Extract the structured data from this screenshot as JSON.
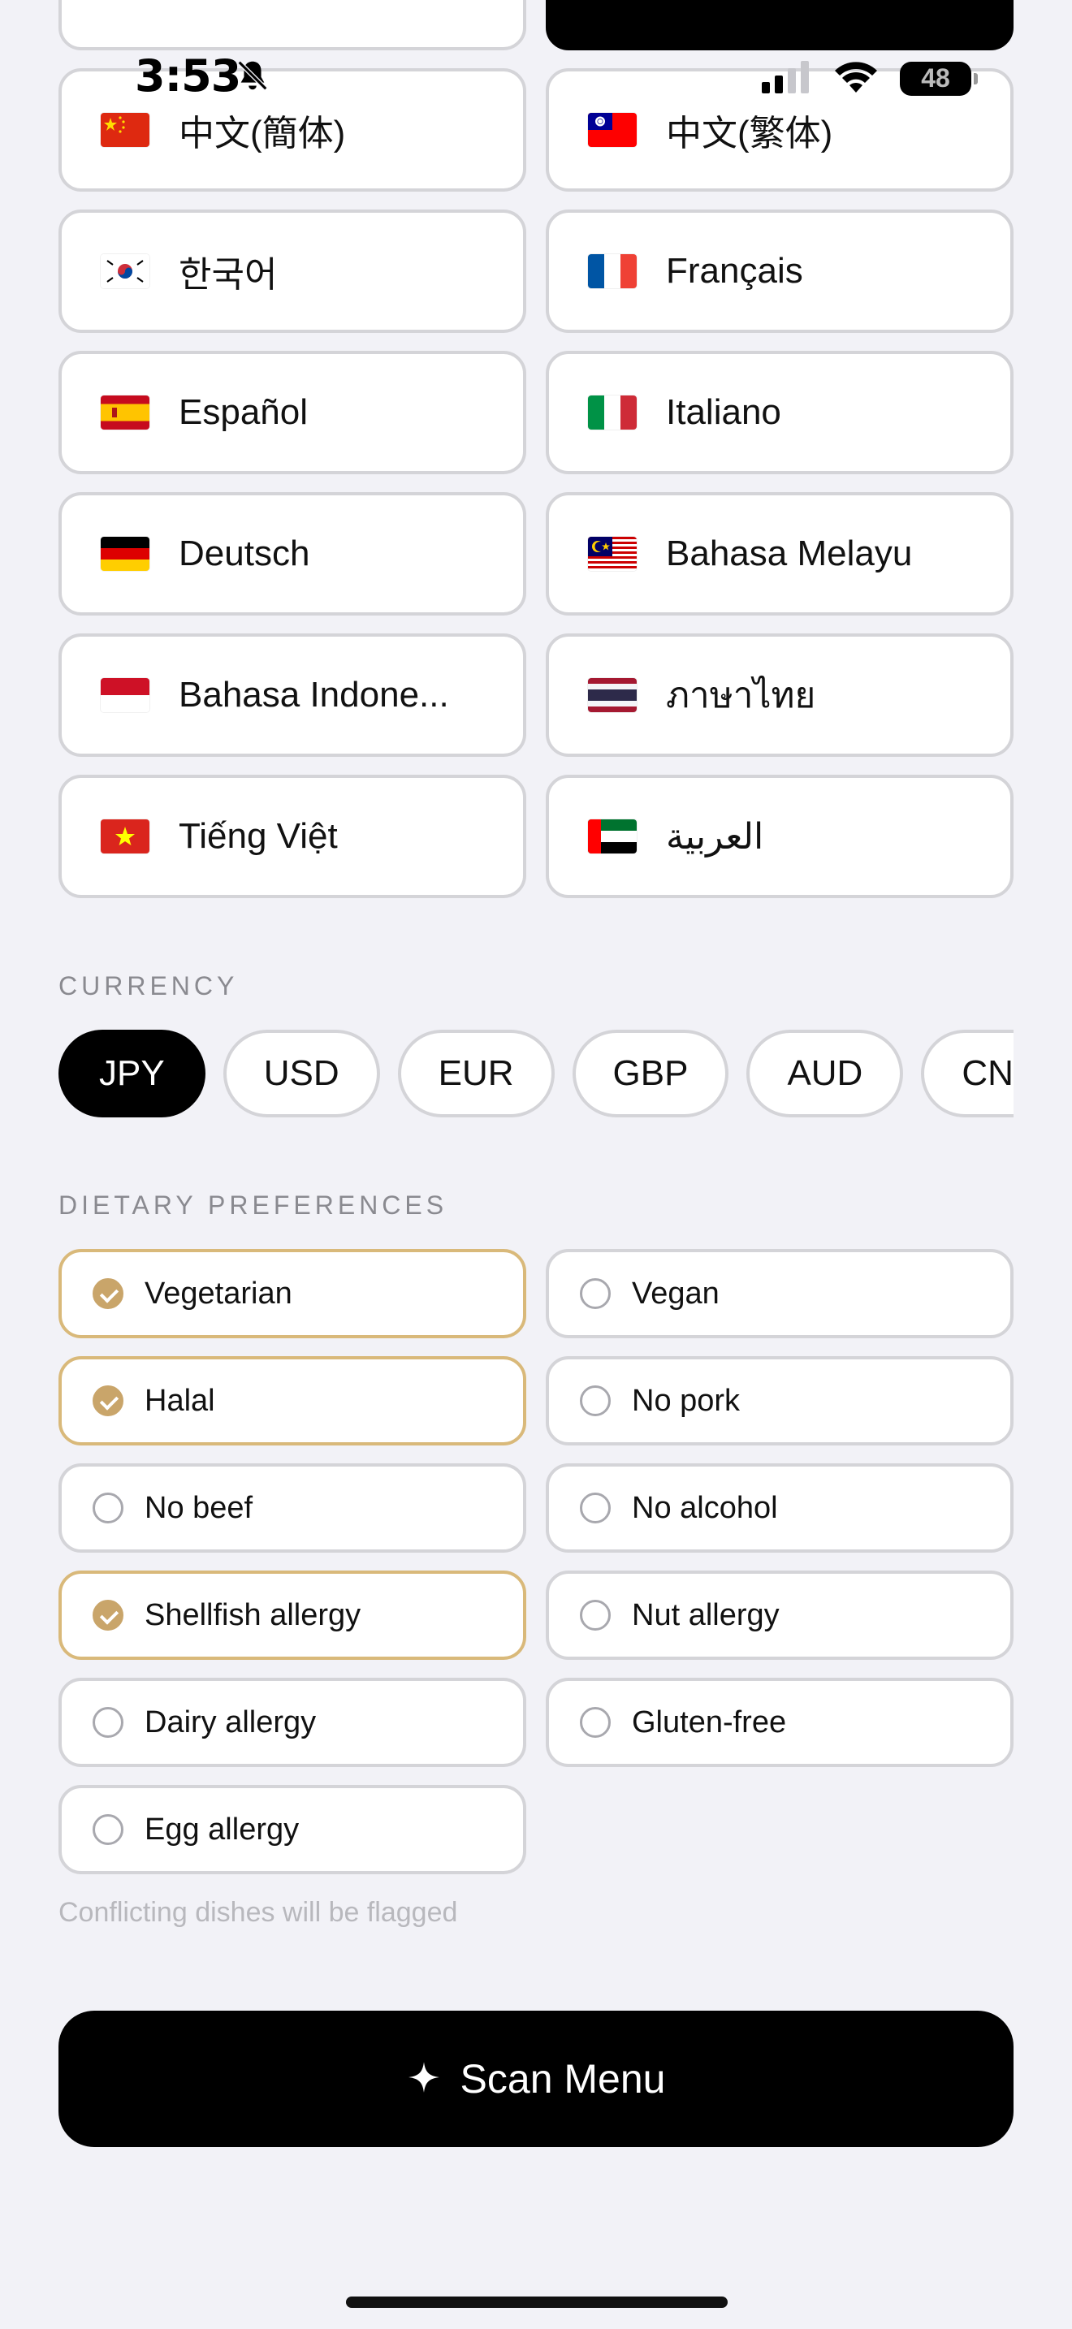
{
  "status_bar": {
    "time": "3:53",
    "battery": "48"
  },
  "languages": [
    {
      "label": "中文(簡体)",
      "flag": "cn"
    },
    {
      "label": "中文(繁体)",
      "flag": "tw"
    },
    {
      "label": "한국어",
      "flag": "kr"
    },
    {
      "label": "Français",
      "flag": "fr"
    },
    {
      "label": "Español",
      "flag": "es"
    },
    {
      "label": "Italiano",
      "flag": "it"
    },
    {
      "label": "Deutsch",
      "flag": "de"
    },
    {
      "label": "Bahasa Melayu",
      "flag": "my"
    },
    {
      "label": "Bahasa Indone...",
      "flag": "id"
    },
    {
      "label": "ภาษาไทย",
      "flag": "th"
    },
    {
      "label": "Tiếng Việt",
      "flag": "vn"
    },
    {
      "label": "العربية",
      "flag": "ae"
    }
  ],
  "currency": {
    "title": "CURRENCY",
    "options": [
      "JPY",
      "USD",
      "EUR",
      "GBP",
      "AUD",
      "CNY"
    ],
    "selected": "JPY"
  },
  "dietary": {
    "title": "DIETARY PREFERENCES",
    "options": [
      {
        "label": "Vegetarian",
        "checked": true
      },
      {
        "label": "Vegan",
        "checked": false
      },
      {
        "label": "Halal",
        "checked": true
      },
      {
        "label": "No pork",
        "checked": false
      },
      {
        "label": "No beef",
        "checked": false
      },
      {
        "label": "No alcohol",
        "checked": false
      },
      {
        "label": "Shellfish allergy",
        "checked": true
      },
      {
        "label": "Nut allergy",
        "checked": false
      },
      {
        "label": "Dairy allergy",
        "checked": false
      },
      {
        "label": "Gluten-free",
        "checked": false
      },
      {
        "label": "Egg allergy",
        "checked": false
      }
    ],
    "hint": "Conflicting dishes will be flagged"
  },
  "scan_button": {
    "label": "Scan Menu"
  },
  "colors": {
    "accent_gold": "#c9a56a",
    "selected_border": "#d9b97a",
    "primary": "#000000",
    "background": "#f2f2f7"
  }
}
